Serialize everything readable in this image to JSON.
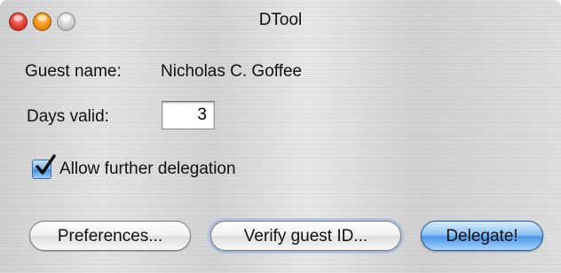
{
  "window": {
    "title": "DTool"
  },
  "form": {
    "guest_name_label": "Guest name:",
    "guest_name_value": "Nicholas C. Goffee",
    "days_valid_label": "Days valid:",
    "days_valid_value": "3",
    "allow_delegation_label": "Allow further delegation",
    "allow_delegation_checked": true
  },
  "buttons": {
    "preferences_label": "Preferences...",
    "verify_label": "Verify guest ID...",
    "delegate_label": "Delegate!"
  },
  "icons": {
    "close": "close-icon",
    "minimize": "minimize-icon",
    "zoom": "zoom-icon",
    "checkmark": "checkmark-icon"
  },
  "colors": {
    "close": "#e8473d",
    "minimize": "#f59a1b",
    "zoom": "#cfcfcf",
    "default_button": "#4d97e6"
  }
}
